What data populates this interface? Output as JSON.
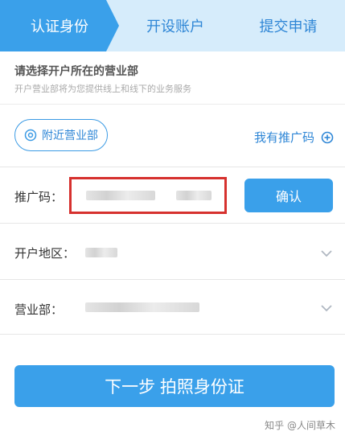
{
  "steps": [
    {
      "label": "认证身份",
      "active": true
    },
    {
      "label": "开设账户",
      "active": false
    },
    {
      "label": "提交申请",
      "active": false
    }
  ],
  "section": {
    "title": "请选择开户所在的营业部",
    "subtitle": "开户营业部将为您提供线上和线下的业务服务"
  },
  "branch_finder": {
    "nearby_label": "附近营业部",
    "nearby_icon": "location-pin-icon",
    "have_code_label": "我有推广码",
    "have_code_icon": "plus-circle-icon"
  },
  "form": {
    "promo_code": {
      "label": "推广码：",
      "value": ""
    },
    "confirm_label": "确认",
    "region": {
      "label": "开户地区：",
      "value": ""
    },
    "branch": {
      "label": "营业部：",
      "value": ""
    }
  },
  "next_button_label": "下一步 拍照身份证",
  "watermark": "知乎 @人间草木",
  "colors": {
    "accent": "#3aa0ea",
    "link": "#2e86d6",
    "highlight_border": "#d6312e",
    "stepbar_bg": "#d6ecfb"
  }
}
